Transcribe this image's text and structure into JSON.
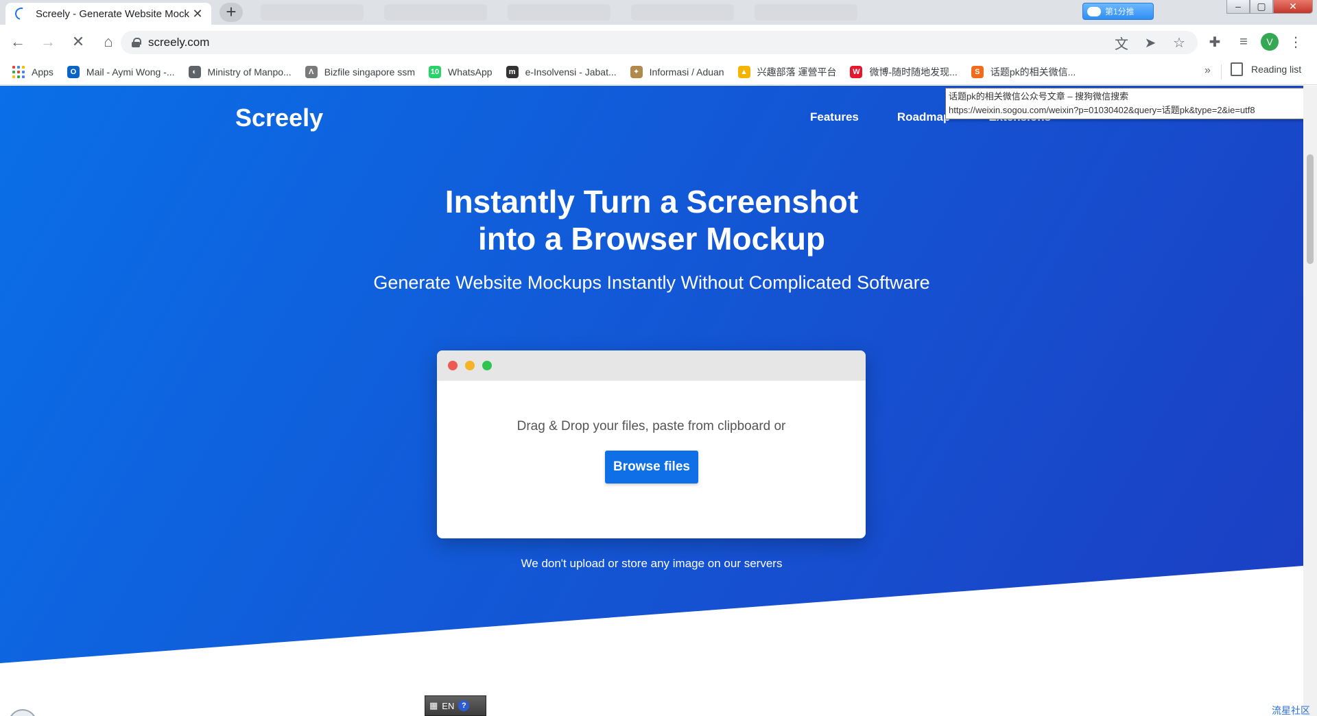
{
  "browser": {
    "tab": {
      "title": "Screely - Generate Website Mock",
      "close": "✕"
    },
    "new_tab": "+",
    "extension_badge": "第1分推",
    "window_controls": {
      "minimize": "–",
      "maximize": "▢",
      "close": "✕"
    },
    "toolbar": {
      "back": "←",
      "forward": "→",
      "stop": "✕",
      "home": "⌂",
      "url": "screely.com",
      "translate": "文",
      "send": "➤",
      "star": "☆",
      "extensions": "✚",
      "media": "≡",
      "avatar": "V",
      "menu": "⋮"
    },
    "bookmarks": [
      {
        "label": "Apps",
        "icon": "apps-grid-icon"
      },
      {
        "label": "Mail - Aymi Wong -...",
        "icon": "outlook-icon",
        "color": "#0a64c8",
        "glyph": "O"
      },
      {
        "label": "Ministry of Manpo...",
        "icon": "globe-icon",
        "color": "#5f6368",
        "glyph": "◐"
      },
      {
        "label": "Bizfile singapore ssm",
        "icon": "bizfile-icon",
        "color": "#7a7a7a",
        "glyph": "Λ"
      },
      {
        "label": "WhatsApp",
        "icon": "whatsapp-icon",
        "color": "#25d366",
        "glyph": "10"
      },
      {
        "label": "e-Insolvensi - Jabat...",
        "icon": "mdi-icon",
        "color": "#333333",
        "glyph": "m"
      },
      {
        "label": "Informasi / Aduan",
        "icon": "crest-icon",
        "color": "#b0894b",
        "glyph": "✦"
      },
      {
        "label": "兴趣部落 運營平台",
        "icon": "warning-icon",
        "color": "#f4b400",
        "glyph": "▲"
      },
      {
        "label": "微博-随时随地发现...",
        "icon": "weibo-icon",
        "color": "#e6162d",
        "glyph": "W"
      },
      {
        "label": "话题pk的相关微信...",
        "icon": "sogou-icon",
        "color": "#f26b1d",
        "glyph": "S"
      }
    ],
    "bookmarks_more": "»",
    "reading_list": "Reading list",
    "tooltip": {
      "line1": "话题pk的相关微信公众号文章 – 搜狗微信搜索",
      "line2": "https://weixin.sogou.com/weixin?p=01030402&query=话题pk&type=2&ie=utf8"
    }
  },
  "site": {
    "logo": "Screely",
    "nav": [
      "Features",
      "Roadmap",
      "Extensions"
    ],
    "headline_line1": "Instantly Turn a Screenshot",
    "headline_line2": "into a Browser Mockup",
    "subheadline": "Generate Website Mockups Instantly Without Complicated Software",
    "upload": {
      "prompt": "Drag & Drop your files, paste from clipboard or",
      "button": "Browse files"
    },
    "privacy_note": "We don't upload or store any image on our servers"
  },
  "os": {
    "ime_language": "EN",
    "ime_help": "?",
    "watermark": "流星社区"
  },
  "colors": {
    "hero_start": "#0a6fe8",
    "hero_end": "#1c3ec2",
    "button": "#0f6fe6",
    "dot_red": "#ee5a52",
    "dot_yellow": "#f5b428",
    "dot_green": "#2fc44f"
  }
}
